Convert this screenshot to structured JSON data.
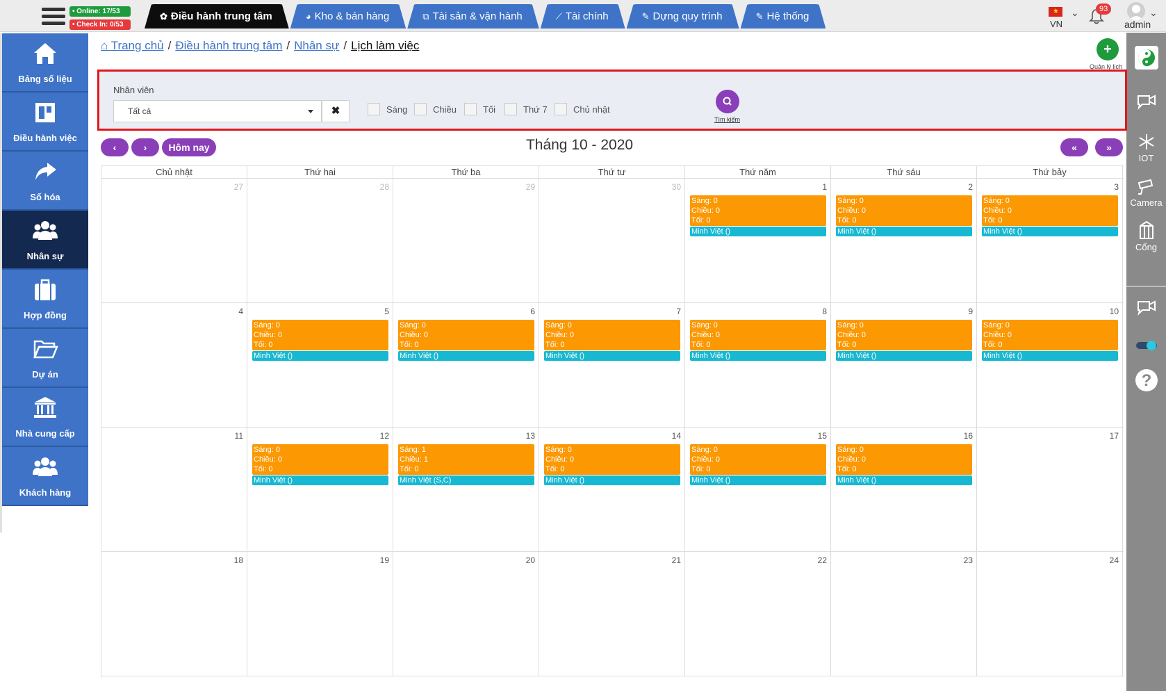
{
  "header": {
    "online": "• Online: 17/53",
    "checkin": "• Check In: 0/53",
    "tabs": [
      {
        "label": "Điều hành trung tâm",
        "icon": "gear-icon",
        "active": true
      },
      {
        "label": "Kho & bán hàng",
        "icon": "pie-chart-icon",
        "active": false
      },
      {
        "label": "Tài sản & vận hành",
        "icon": "cubes-icon",
        "active": false
      },
      {
        "label": "Tài chính",
        "icon": "line-chart-icon",
        "active": false
      },
      {
        "label": "Dựng quy trình",
        "icon": "edit-icon",
        "active": false
      },
      {
        "label": "Hệ thống",
        "icon": "edit-icon",
        "active": false
      }
    ],
    "lang": "VN",
    "notif_count": "93",
    "user": "admin"
  },
  "sidebar": {
    "items": [
      {
        "label": "Bảng số liệu",
        "icon": "home-icon"
      },
      {
        "label": "Điều hành việc",
        "icon": "board-icon"
      },
      {
        "label": "Số hóa",
        "icon": "share-arrow-icon"
      },
      {
        "label": "Nhân sự",
        "icon": "users-icon",
        "active": true
      },
      {
        "label": "Hợp đồng",
        "icon": "briefcase-icon"
      },
      {
        "label": "Dự án",
        "icon": "folder-icon"
      },
      {
        "label": "Nhà cung cấp",
        "icon": "bank-icon"
      },
      {
        "label": "Khách hàng",
        "icon": "users-icon"
      }
    ]
  },
  "rightbar": {
    "iot": "IOT",
    "camera": "Camera",
    "gate": "Cổng"
  },
  "breadcrumb": [
    "Trang chủ",
    "Điều hành trung tâm",
    "Nhân sự",
    "Lịch làm việc"
  ],
  "add_caption": "Quản lý lịch",
  "filter": {
    "employee_label": "Nhân viên",
    "employee_value": "Tất cả",
    "checkboxes": [
      "Sáng",
      "Chiều",
      "Tối",
      "Thứ 7",
      "Chủ nhật"
    ],
    "search_caption": "Tìm kiếm"
  },
  "calendar_nav": {
    "prev": "‹",
    "next": "›",
    "today": "Hôm nay",
    "prev_year": "«",
    "next_year": "»",
    "title": "Tháng 10 - 2020"
  },
  "calendar": {
    "days_of_week": [
      "Chủ nhật",
      "Thứ hai",
      "Thứ ba",
      "Thứ tư",
      "Thứ năm",
      "Thứ sáu",
      "Thứ bảy"
    ],
    "weeks": [
      [
        {
          "num": "27",
          "other": true
        },
        {
          "num": "28",
          "other": true
        },
        {
          "num": "29",
          "other": true
        },
        {
          "num": "30",
          "other": true
        },
        {
          "num": "1",
          "event": {
            "morning": "Sáng: 0",
            "afternoon": "Chiều: 0",
            "evening": "Tối: 0",
            "name": "Minh Việt ()"
          }
        },
        {
          "num": "2",
          "event": {
            "morning": "Sáng: 0",
            "afternoon": "Chiều: 0",
            "evening": "Tối: 0",
            "name": "Minh Việt ()"
          }
        },
        {
          "num": "3",
          "event": {
            "morning": "Sáng: 0",
            "afternoon": "Chiều: 0",
            "evening": "Tối: 0",
            "name": "Minh Việt ()"
          }
        }
      ],
      [
        {
          "num": "4"
        },
        {
          "num": "5",
          "event": {
            "morning": "Sáng: 0",
            "afternoon": "Chiều: 0",
            "evening": "Tối: 0",
            "name": "Minh Việt ()"
          }
        },
        {
          "num": "6",
          "event": {
            "morning": "Sáng: 0",
            "afternoon": "Chiều: 0",
            "evening": "Tối: 0",
            "name": "Minh Việt ()"
          }
        },
        {
          "num": "7",
          "event": {
            "morning": "Sáng: 0",
            "afternoon": "Chiều: 0",
            "evening": "Tối: 0",
            "name": "Minh Việt ()"
          }
        },
        {
          "num": "8",
          "event": {
            "morning": "Sáng: 0",
            "afternoon": "Chiều: 0",
            "evening": "Tối: 0",
            "name": "Minh Việt ()"
          }
        },
        {
          "num": "9",
          "event": {
            "morning": "Sáng: 0",
            "afternoon": "Chiều: 0",
            "evening": "Tối: 0",
            "name": "Minh Việt ()"
          }
        },
        {
          "num": "10",
          "event": {
            "morning": "Sáng: 0",
            "afternoon": "Chiều: 0",
            "evening": "Tối: 0",
            "name": "Minh Việt ()"
          }
        }
      ],
      [
        {
          "num": "11"
        },
        {
          "num": "12",
          "event": {
            "morning": "Sáng: 0",
            "afternoon": "Chiều: 0",
            "evening": "Tối: 0",
            "name": "Minh Việt ()"
          }
        },
        {
          "num": "13",
          "event": {
            "morning": "Sáng: 1",
            "afternoon": "Chiều: 1",
            "evening": "Tối: 0",
            "name": "Minh Việt (S,C)"
          }
        },
        {
          "num": "14",
          "event": {
            "morning": "Sáng: 0",
            "afternoon": "Chiều: 0",
            "evening": "Tối: 0",
            "name": "Minh Việt ()"
          }
        },
        {
          "num": "15",
          "event": {
            "morning": "Sáng: 0",
            "afternoon": "Chiều: 0",
            "evening": "Tối: 0",
            "name": "Minh Việt ()"
          }
        },
        {
          "num": "16",
          "event": {
            "morning": "Sáng: 0",
            "afternoon": "Chiều: 0",
            "evening": "Tối: 0",
            "name": "Minh Việt ()"
          }
        },
        {
          "num": "17"
        }
      ],
      [
        {
          "num": "18"
        },
        {
          "num": "19"
        },
        {
          "num": "20"
        },
        {
          "num": "21"
        },
        {
          "num": "22"
        },
        {
          "num": "23"
        },
        {
          "num": "24"
        }
      ]
    ]
  },
  "colors": {
    "tab_blue": "#3e73c7",
    "sidebar_active": "#14294f",
    "shift_orange": "#fb9802",
    "name_cyan": "#17b8d2",
    "nav_purple": "#8a3fb8",
    "add_green": "#1e9b3c",
    "filter_border_red": "#e0171c"
  }
}
